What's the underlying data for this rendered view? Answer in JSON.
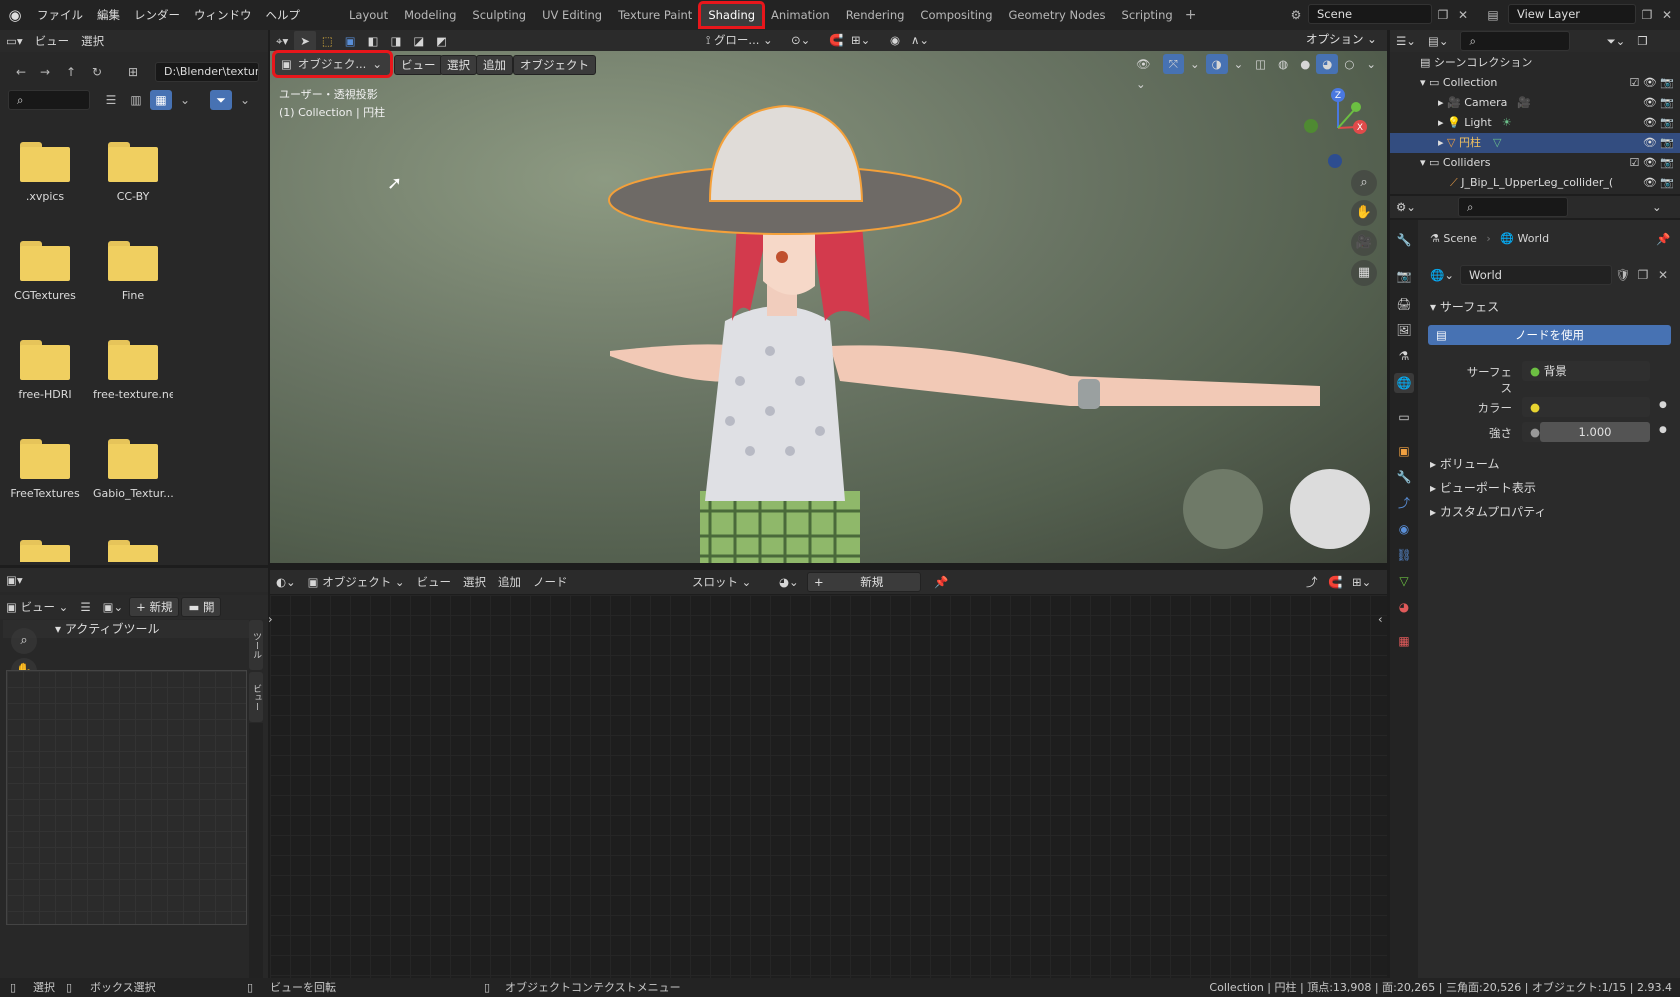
{
  "topbar": {
    "menus": [
      "ファイル",
      "編集",
      "レンダー",
      "ウィンドウ",
      "ヘルプ"
    ],
    "workspaces": [
      "Layout",
      "Modeling",
      "Sculpting",
      "UV Editing",
      "Texture Paint",
      "Shading",
      "Animation",
      "Rendering",
      "Compositing",
      "Geometry Nodes",
      "Scripting"
    ],
    "active_workspace": "Shading",
    "scene": "Scene",
    "view_layer": "View Layer"
  },
  "file_browser": {
    "header_menus": [
      "ビュー",
      "選択"
    ],
    "path": "D:\\Blender\\texture\\",
    "folders": [
      ".xvpics",
      "CC-BY",
      "CGTextures",
      "Fine",
      "free-HDRI",
      "free-texture.ne",
      "FreeTextures",
      "Gabio_Textur..."
    ]
  },
  "viewport": {
    "mode": "オブジェク...",
    "menus": [
      "ビュー",
      "選択",
      "追加",
      "オブジェクト"
    ],
    "transform": "グロー...",
    "options": "オプション",
    "info_line1": "ユーザー・透視投影",
    "info_line2": "(1) Collection | 円柱"
  },
  "image_editor": {
    "view": "ビュー",
    "new": "新規",
    "open": "開",
    "tool_panel": "アクティブツール",
    "side_tabs": [
      "ツール",
      "ビュー"
    ]
  },
  "node_editor": {
    "mode": "オブジェクト",
    "menus": [
      "ビュー",
      "選択",
      "追加",
      "ノード"
    ],
    "slot": "スロット",
    "new": "新規"
  },
  "outliner": {
    "root": "シーンコレクション",
    "items": [
      {
        "name": "Collection",
        "level": 1
      },
      {
        "name": "Camera",
        "level": 2
      },
      {
        "name": "Light",
        "level": 2
      },
      {
        "name": "円柱",
        "level": 2
      },
      {
        "name": "Colliders",
        "level": 1
      },
      {
        "name": "J_Bip_L_UpperLeg_collider_(",
        "level": 2
      }
    ]
  },
  "properties": {
    "breadcrumb_scene": "Scene",
    "breadcrumb_world": "World",
    "world_name": "World",
    "surface_section": "サーフェス",
    "use_nodes": "ノードを使用",
    "surface_label": "サーフェス",
    "surface_value": "背景",
    "color_label": "カラー",
    "strength_label": "強さ",
    "strength_value": "1.000",
    "volume": "ボリューム",
    "viewport_display": "ビューポート表示",
    "custom_props": "カスタムプロパティ"
  },
  "statusbar": {
    "select": "選択",
    "box_select": "ボックス選択",
    "rotate_view": "ビューを回転",
    "context_menu": "オブジェクトコンテクストメニュー",
    "stats": "Collection | 円柱 | 頂点:13,908 | 面:20,265 | 三角面:20,526 | オブジェクト:1/15 | 2.93.4"
  }
}
